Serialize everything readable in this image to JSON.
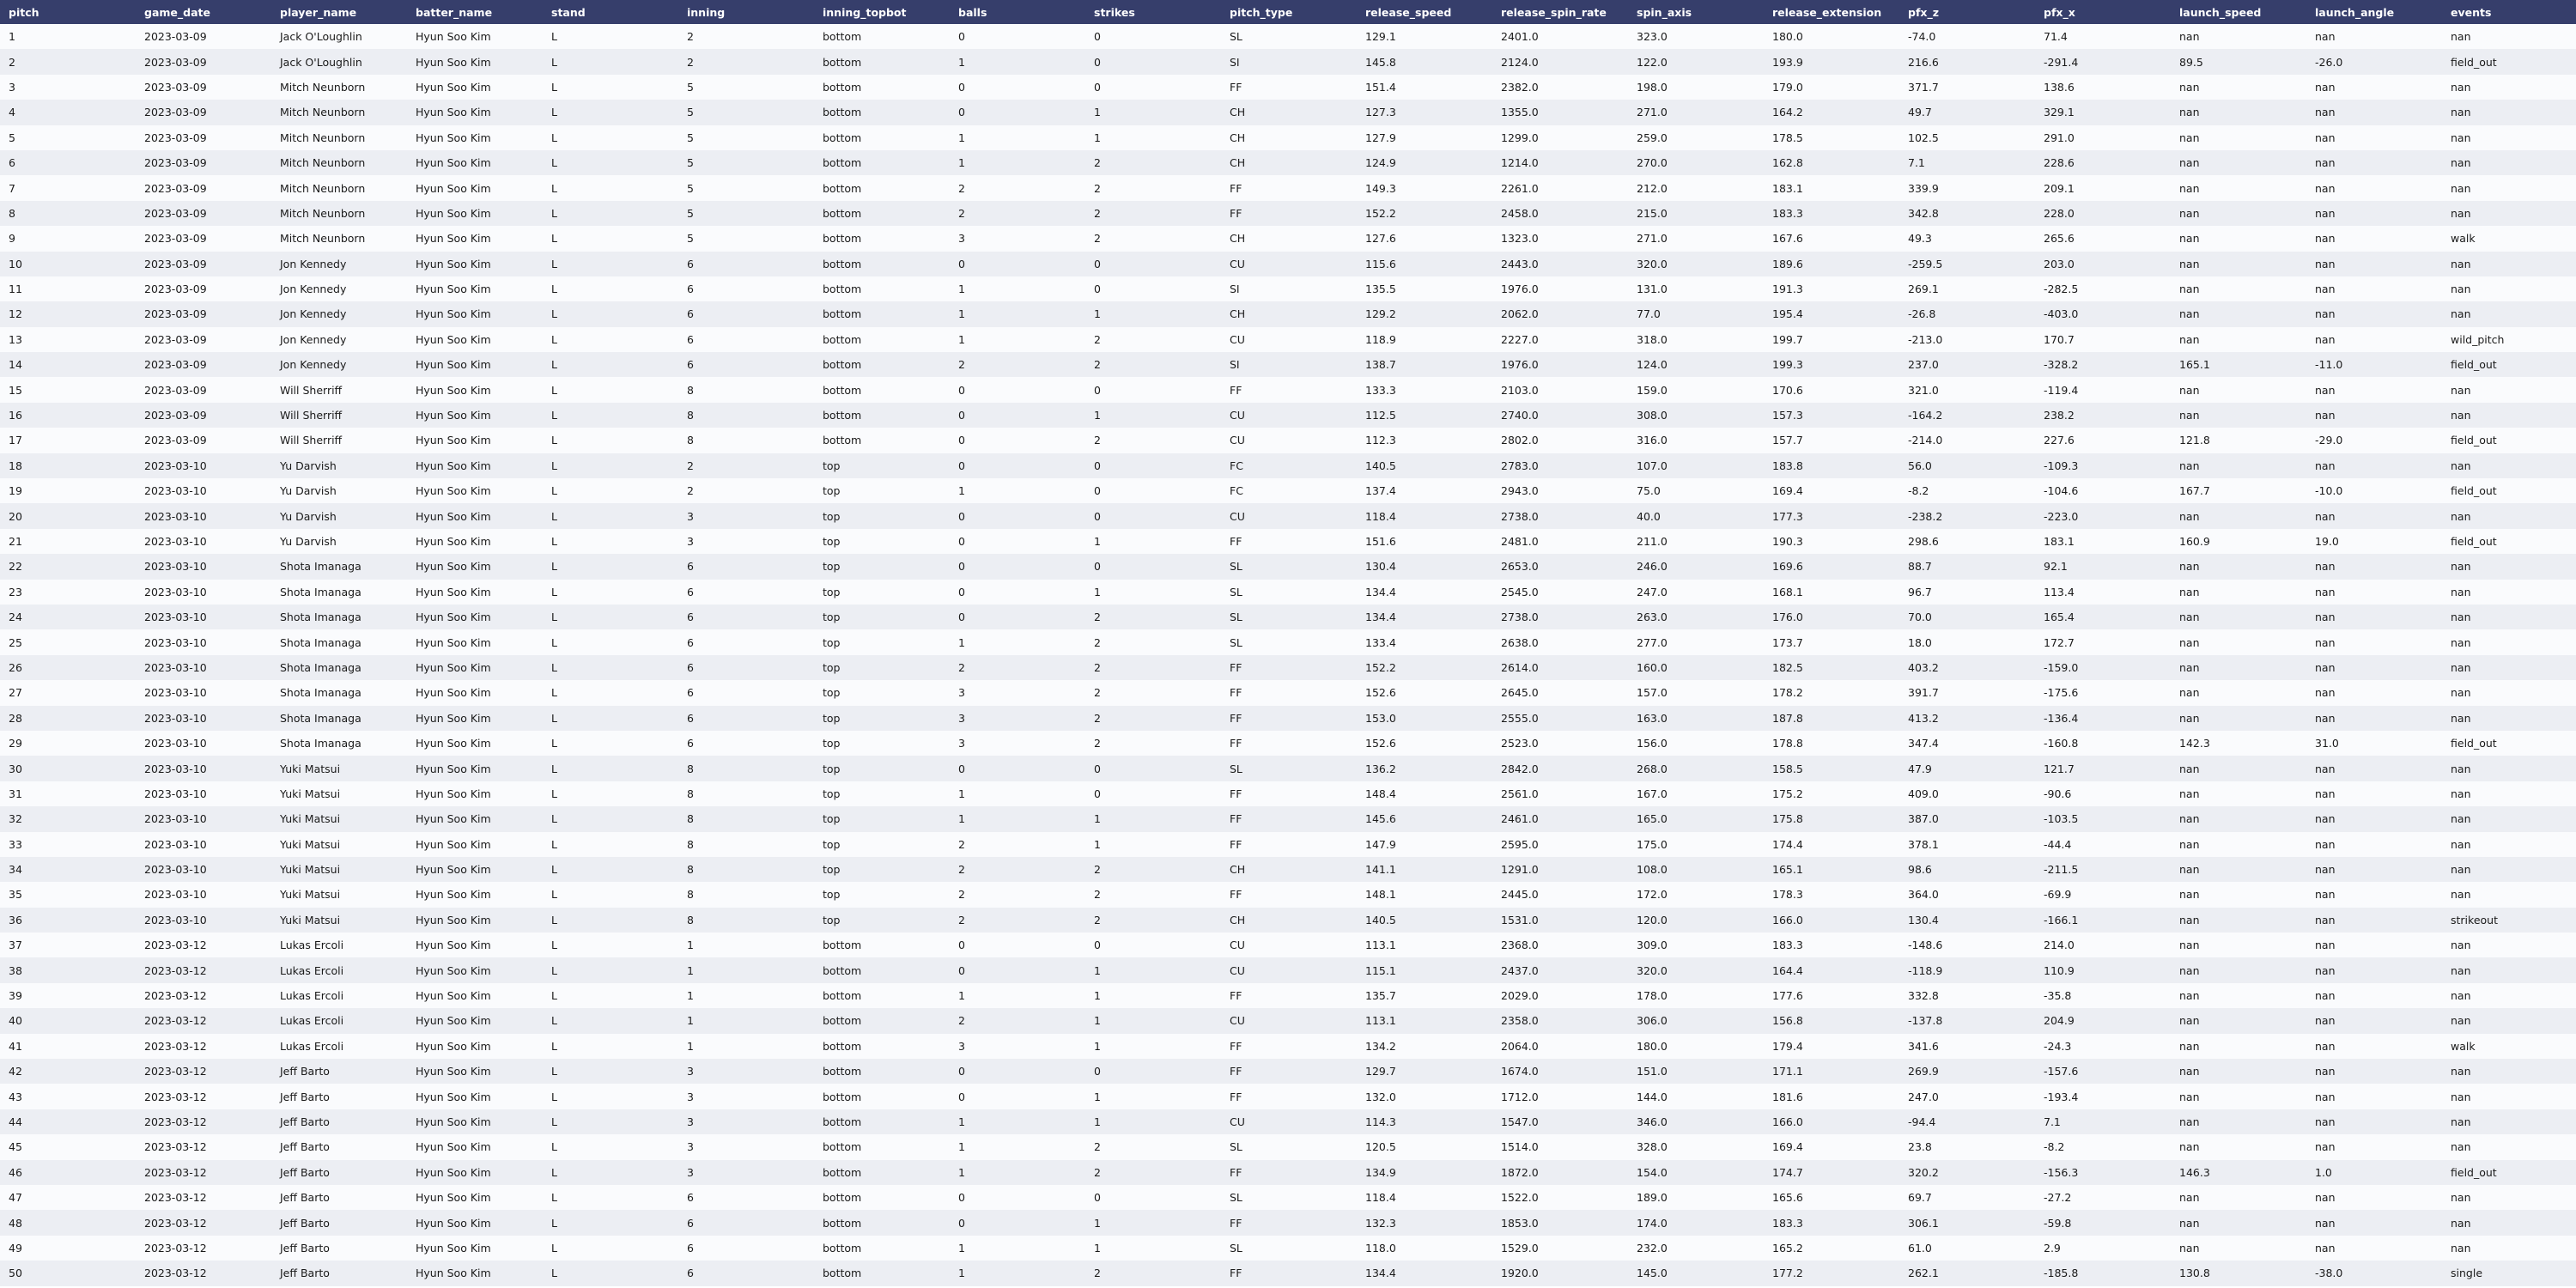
{
  "columns": [
    "pitch",
    "game_date",
    "player_name",
    "batter_name",
    "stand",
    "inning",
    "inning_topbot",
    "balls",
    "strikes",
    "pitch_type",
    "release_speed",
    "release_spin_rate",
    "spin_axis",
    "release_extension",
    "pfx_z",
    "pfx_x",
    "launch_speed",
    "launch_angle",
    "events"
  ],
  "rows": [
    [
      "1",
      "2023-03-09",
      "Jack O'Loughlin",
      "Hyun Soo Kim",
      "L",
      "2",
      "bottom",
      "0",
      "0",
      "SL",
      "129.1",
      "2401.0",
      "323.0",
      "180.0",
      "-74.0",
      "71.4",
      "nan",
      "nan",
      "nan"
    ],
    [
      "2",
      "2023-03-09",
      "Jack O'Loughlin",
      "Hyun Soo Kim",
      "L",
      "2",
      "bottom",
      "1",
      "0",
      "SI",
      "145.8",
      "2124.0",
      "122.0",
      "193.9",
      "216.6",
      "-291.4",
      "89.5",
      "-26.0",
      "field_out"
    ],
    [
      "3",
      "2023-03-09",
      "Mitch Neunborn",
      "Hyun Soo Kim",
      "L",
      "5",
      "bottom",
      "0",
      "0",
      "FF",
      "151.4",
      "2382.0",
      "198.0",
      "179.0",
      "371.7",
      "138.6",
      "nan",
      "nan",
      "nan"
    ],
    [
      "4",
      "2023-03-09",
      "Mitch Neunborn",
      "Hyun Soo Kim",
      "L",
      "5",
      "bottom",
      "0",
      "1",
      "CH",
      "127.3",
      "1355.0",
      "271.0",
      "164.2",
      "49.7",
      "329.1",
      "nan",
      "nan",
      "nan"
    ],
    [
      "5",
      "2023-03-09",
      "Mitch Neunborn",
      "Hyun Soo Kim",
      "L",
      "5",
      "bottom",
      "1",
      "1",
      "CH",
      "127.9",
      "1299.0",
      "259.0",
      "178.5",
      "102.5",
      "291.0",
      "nan",
      "nan",
      "nan"
    ],
    [
      "6",
      "2023-03-09",
      "Mitch Neunborn",
      "Hyun Soo Kim",
      "L",
      "5",
      "bottom",
      "1",
      "2",
      "CH",
      "124.9",
      "1214.0",
      "270.0",
      "162.8",
      "7.1",
      "228.6",
      "nan",
      "nan",
      "nan"
    ],
    [
      "7",
      "2023-03-09",
      "Mitch Neunborn",
      "Hyun Soo Kim",
      "L",
      "5",
      "bottom",
      "2",
      "2",
      "FF",
      "149.3",
      "2261.0",
      "212.0",
      "183.1",
      "339.9",
      "209.1",
      "nan",
      "nan",
      "nan"
    ],
    [
      "8",
      "2023-03-09",
      "Mitch Neunborn",
      "Hyun Soo Kim",
      "L",
      "5",
      "bottom",
      "2",
      "2",
      "FF",
      "152.2",
      "2458.0",
      "215.0",
      "183.3",
      "342.8",
      "228.0",
      "nan",
      "nan",
      "nan"
    ],
    [
      "9",
      "2023-03-09",
      "Mitch Neunborn",
      "Hyun Soo Kim",
      "L",
      "5",
      "bottom",
      "3",
      "2",
      "CH",
      "127.6",
      "1323.0",
      "271.0",
      "167.6",
      "49.3",
      "265.6",
      "nan",
      "nan",
      "walk"
    ],
    [
      "10",
      "2023-03-09",
      "Jon Kennedy",
      "Hyun Soo Kim",
      "L",
      "6",
      "bottom",
      "0",
      "0",
      "CU",
      "115.6",
      "2443.0",
      "320.0",
      "189.6",
      "-259.5",
      "203.0",
      "nan",
      "nan",
      "nan"
    ],
    [
      "11",
      "2023-03-09",
      "Jon Kennedy",
      "Hyun Soo Kim",
      "L",
      "6",
      "bottom",
      "1",
      "0",
      "SI",
      "135.5",
      "1976.0",
      "131.0",
      "191.3",
      "269.1",
      "-282.5",
      "nan",
      "nan",
      "nan"
    ],
    [
      "12",
      "2023-03-09",
      "Jon Kennedy",
      "Hyun Soo Kim",
      "L",
      "6",
      "bottom",
      "1",
      "1",
      "CH",
      "129.2",
      "2062.0",
      "77.0",
      "195.4",
      "-26.8",
      "-403.0",
      "nan",
      "nan",
      "nan"
    ],
    [
      "13",
      "2023-03-09",
      "Jon Kennedy",
      "Hyun Soo Kim",
      "L",
      "6",
      "bottom",
      "1",
      "2",
      "CU",
      "118.9",
      "2227.0",
      "318.0",
      "199.7",
      "-213.0",
      "170.7",
      "nan",
      "nan",
      "wild_pitch"
    ],
    [
      "14",
      "2023-03-09",
      "Jon Kennedy",
      "Hyun Soo Kim",
      "L",
      "6",
      "bottom",
      "2",
      "2",
      "SI",
      "138.7",
      "1976.0",
      "124.0",
      "199.3",
      "237.0",
      "-328.2",
      "165.1",
      "-11.0",
      "field_out"
    ],
    [
      "15",
      "2023-03-09",
      "Will Sherriff",
      "Hyun Soo Kim",
      "L",
      "8",
      "bottom",
      "0",
      "0",
      "FF",
      "133.3",
      "2103.0",
      "159.0",
      "170.6",
      "321.0",
      "-119.4",
      "nan",
      "nan",
      "nan"
    ],
    [
      "16",
      "2023-03-09",
      "Will Sherriff",
      "Hyun Soo Kim",
      "L",
      "8",
      "bottom",
      "0",
      "1",
      "CU",
      "112.5",
      "2740.0",
      "308.0",
      "157.3",
      "-164.2",
      "238.2",
      "nan",
      "nan",
      "nan"
    ],
    [
      "17",
      "2023-03-09",
      "Will Sherriff",
      "Hyun Soo Kim",
      "L",
      "8",
      "bottom",
      "0",
      "2",
      "CU",
      "112.3",
      "2802.0",
      "316.0",
      "157.7",
      "-214.0",
      "227.6",
      "121.8",
      "-29.0",
      "field_out"
    ],
    [
      "18",
      "2023-03-10",
      "Yu Darvish",
      "Hyun Soo Kim",
      "L",
      "2",
      "top",
      "0",
      "0",
      "FC",
      "140.5",
      "2783.0",
      "107.0",
      "183.8",
      "56.0",
      "-109.3",
      "nan",
      "nan",
      "nan"
    ],
    [
      "19",
      "2023-03-10",
      "Yu Darvish",
      "Hyun Soo Kim",
      "L",
      "2",
      "top",
      "1",
      "0",
      "FC",
      "137.4",
      "2943.0",
      "75.0",
      "169.4",
      "-8.2",
      "-104.6",
      "167.7",
      "-10.0",
      "field_out"
    ],
    [
      "20",
      "2023-03-10",
      "Yu Darvish",
      "Hyun Soo Kim",
      "L",
      "3",
      "top",
      "0",
      "0",
      "CU",
      "118.4",
      "2738.0",
      "40.0",
      "177.3",
      "-238.2",
      "-223.0",
      "nan",
      "nan",
      "nan"
    ],
    [
      "21",
      "2023-03-10",
      "Yu Darvish",
      "Hyun Soo Kim",
      "L",
      "3",
      "top",
      "0",
      "1",
      "FF",
      "151.6",
      "2481.0",
      "211.0",
      "190.3",
      "298.6",
      "183.1",
      "160.9",
      "19.0",
      "field_out"
    ],
    [
      "22",
      "2023-03-10",
      "Shota Imanaga",
      "Hyun Soo Kim",
      "L",
      "6",
      "top",
      "0",
      "0",
      "SL",
      "130.4",
      "2653.0",
      "246.0",
      "169.6",
      "88.7",
      "92.1",
      "nan",
      "nan",
      "nan"
    ],
    [
      "23",
      "2023-03-10",
      "Shota Imanaga",
      "Hyun Soo Kim",
      "L",
      "6",
      "top",
      "0",
      "1",
      "SL",
      "134.4",
      "2545.0",
      "247.0",
      "168.1",
      "96.7",
      "113.4",
      "nan",
      "nan",
      "nan"
    ],
    [
      "24",
      "2023-03-10",
      "Shota Imanaga",
      "Hyun Soo Kim",
      "L",
      "6",
      "top",
      "0",
      "2",
      "SL",
      "134.4",
      "2738.0",
      "263.0",
      "176.0",
      "70.0",
      "165.4",
      "nan",
      "nan",
      "nan"
    ],
    [
      "25",
      "2023-03-10",
      "Shota Imanaga",
      "Hyun Soo Kim",
      "L",
      "6",
      "top",
      "1",
      "2",
      "SL",
      "133.4",
      "2638.0",
      "277.0",
      "173.7",
      "18.0",
      "172.7",
      "nan",
      "nan",
      "nan"
    ],
    [
      "26",
      "2023-03-10",
      "Shota Imanaga",
      "Hyun Soo Kim",
      "L",
      "6",
      "top",
      "2",
      "2",
      "FF",
      "152.2",
      "2614.0",
      "160.0",
      "182.5",
      "403.2",
      "-159.0",
      "nan",
      "nan",
      "nan"
    ],
    [
      "27",
      "2023-03-10",
      "Shota Imanaga",
      "Hyun Soo Kim",
      "L",
      "6",
      "top",
      "3",
      "2",
      "FF",
      "152.6",
      "2645.0",
      "157.0",
      "178.2",
      "391.7",
      "-175.6",
      "nan",
      "nan",
      "nan"
    ],
    [
      "28",
      "2023-03-10",
      "Shota Imanaga",
      "Hyun Soo Kim",
      "L",
      "6",
      "top",
      "3",
      "2",
      "FF",
      "153.0",
      "2555.0",
      "163.0",
      "187.8",
      "413.2",
      "-136.4",
      "nan",
      "nan",
      "nan"
    ],
    [
      "29",
      "2023-03-10",
      "Shota Imanaga",
      "Hyun Soo Kim",
      "L",
      "6",
      "top",
      "3",
      "2",
      "FF",
      "152.6",
      "2523.0",
      "156.0",
      "178.8",
      "347.4",
      "-160.8",
      "142.3",
      "31.0",
      "field_out"
    ],
    [
      "30",
      "2023-03-10",
      "Yuki Matsui",
      "Hyun Soo Kim",
      "L",
      "8",
      "top",
      "0",
      "0",
      "SL",
      "136.2",
      "2842.0",
      "268.0",
      "158.5",
      "47.9",
      "121.7",
      "nan",
      "nan",
      "nan"
    ],
    [
      "31",
      "2023-03-10",
      "Yuki Matsui",
      "Hyun Soo Kim",
      "L",
      "8",
      "top",
      "1",
      "0",
      "FF",
      "148.4",
      "2561.0",
      "167.0",
      "175.2",
      "409.0",
      "-90.6",
      "nan",
      "nan",
      "nan"
    ],
    [
      "32",
      "2023-03-10",
      "Yuki Matsui",
      "Hyun Soo Kim",
      "L",
      "8",
      "top",
      "1",
      "1",
      "FF",
      "145.6",
      "2461.0",
      "165.0",
      "175.8",
      "387.0",
      "-103.5",
      "nan",
      "nan",
      "nan"
    ],
    [
      "33",
      "2023-03-10",
      "Yuki Matsui",
      "Hyun Soo Kim",
      "L",
      "8",
      "top",
      "2",
      "1",
      "FF",
      "147.9",
      "2595.0",
      "175.0",
      "174.4",
      "378.1",
      "-44.4",
      "nan",
      "nan",
      "nan"
    ],
    [
      "34",
      "2023-03-10",
      "Yuki Matsui",
      "Hyun Soo Kim",
      "L",
      "8",
      "top",
      "2",
      "2",
      "CH",
      "141.1",
      "1291.0",
      "108.0",
      "165.1",
      "98.6",
      "-211.5",
      "nan",
      "nan",
      "nan"
    ],
    [
      "35",
      "2023-03-10",
      "Yuki Matsui",
      "Hyun Soo Kim",
      "L",
      "8",
      "top",
      "2",
      "2",
      "FF",
      "148.1",
      "2445.0",
      "172.0",
      "178.3",
      "364.0",
      "-69.9",
      "nan",
      "nan",
      "nan"
    ],
    [
      "36",
      "2023-03-10",
      "Yuki Matsui",
      "Hyun Soo Kim",
      "L",
      "8",
      "top",
      "2",
      "2",
      "CH",
      "140.5",
      "1531.0",
      "120.0",
      "166.0",
      "130.4",
      "-166.1",
      "nan",
      "nan",
      "strikeout"
    ],
    [
      "37",
      "2023-03-12",
      "Lukas Ercoli",
      "Hyun Soo Kim",
      "L",
      "1",
      "bottom",
      "0",
      "0",
      "CU",
      "113.1",
      "2368.0",
      "309.0",
      "183.3",
      "-148.6",
      "214.0",
      "nan",
      "nan",
      "nan"
    ],
    [
      "38",
      "2023-03-12",
      "Lukas Ercoli",
      "Hyun Soo Kim",
      "L",
      "1",
      "bottom",
      "0",
      "1",
      "CU",
      "115.1",
      "2437.0",
      "320.0",
      "164.4",
      "-118.9",
      "110.9",
      "nan",
      "nan",
      "nan"
    ],
    [
      "39",
      "2023-03-12",
      "Lukas Ercoli",
      "Hyun Soo Kim",
      "L",
      "1",
      "bottom",
      "1",
      "1",
      "FF",
      "135.7",
      "2029.0",
      "178.0",
      "177.6",
      "332.8",
      "-35.8",
      "nan",
      "nan",
      "nan"
    ],
    [
      "40",
      "2023-03-12",
      "Lukas Ercoli",
      "Hyun Soo Kim",
      "L",
      "1",
      "bottom",
      "2",
      "1",
      "CU",
      "113.1",
      "2358.0",
      "306.0",
      "156.8",
      "-137.8",
      "204.9",
      "nan",
      "nan",
      "nan"
    ],
    [
      "41",
      "2023-03-12",
      "Lukas Ercoli",
      "Hyun Soo Kim",
      "L",
      "1",
      "bottom",
      "3",
      "1",
      "FF",
      "134.2",
      "2064.0",
      "180.0",
      "179.4",
      "341.6",
      "-24.3",
      "nan",
      "nan",
      "walk"
    ],
    [
      "42",
      "2023-03-12",
      "Jeff Barto",
      "Hyun Soo Kim",
      "L",
      "3",
      "bottom",
      "0",
      "0",
      "FF",
      "129.7",
      "1674.0",
      "151.0",
      "171.1",
      "269.9",
      "-157.6",
      "nan",
      "nan",
      "nan"
    ],
    [
      "43",
      "2023-03-12",
      "Jeff Barto",
      "Hyun Soo Kim",
      "L",
      "3",
      "bottom",
      "0",
      "1",
      "FF",
      "132.0",
      "1712.0",
      "144.0",
      "181.6",
      "247.0",
      "-193.4",
      "nan",
      "nan",
      "nan"
    ],
    [
      "44",
      "2023-03-12",
      "Jeff Barto",
      "Hyun Soo Kim",
      "L",
      "3",
      "bottom",
      "1",
      "1",
      "CU",
      "114.3",
      "1547.0",
      "346.0",
      "166.0",
      "-94.4",
      "7.1",
      "nan",
      "nan",
      "nan"
    ],
    [
      "45",
      "2023-03-12",
      "Jeff Barto",
      "Hyun Soo Kim",
      "L",
      "3",
      "bottom",
      "1",
      "2",
      "SL",
      "120.5",
      "1514.0",
      "328.0",
      "169.4",
      "23.8",
      "-8.2",
      "nan",
      "nan",
      "nan"
    ],
    [
      "46",
      "2023-03-12",
      "Jeff Barto",
      "Hyun Soo Kim",
      "L",
      "3",
      "bottom",
      "1",
      "2",
      "FF",
      "134.9",
      "1872.0",
      "154.0",
      "174.7",
      "320.2",
      "-156.3",
      "146.3",
      "1.0",
      "field_out"
    ],
    [
      "47",
      "2023-03-12",
      "Jeff Barto",
      "Hyun Soo Kim",
      "L",
      "6",
      "bottom",
      "0",
      "0",
      "SL",
      "118.4",
      "1522.0",
      "189.0",
      "165.6",
      "69.7",
      "-27.2",
      "nan",
      "nan",
      "nan"
    ],
    [
      "48",
      "2023-03-12",
      "Jeff Barto",
      "Hyun Soo Kim",
      "L",
      "6",
      "bottom",
      "0",
      "1",
      "FF",
      "132.3",
      "1853.0",
      "174.0",
      "183.3",
      "306.1",
      "-59.8",
      "nan",
      "nan",
      "nan"
    ],
    [
      "49",
      "2023-03-12",
      "Jeff Barto",
      "Hyun Soo Kim",
      "L",
      "6",
      "bottom",
      "1",
      "1",
      "SL",
      "118.0",
      "1529.0",
      "232.0",
      "165.2",
      "61.0",
      "2.9",
      "nan",
      "nan",
      "nan"
    ],
    [
      "50",
      "2023-03-12",
      "Jeff Barto",
      "Hyun Soo Kim",
      "L",
      "6",
      "bottom",
      "1",
      "2",
      "FF",
      "134.4",
      "1920.0",
      "145.0",
      "177.2",
      "262.1",
      "-185.8",
      "130.8",
      "-38.0",
      "single"
    ]
  ]
}
